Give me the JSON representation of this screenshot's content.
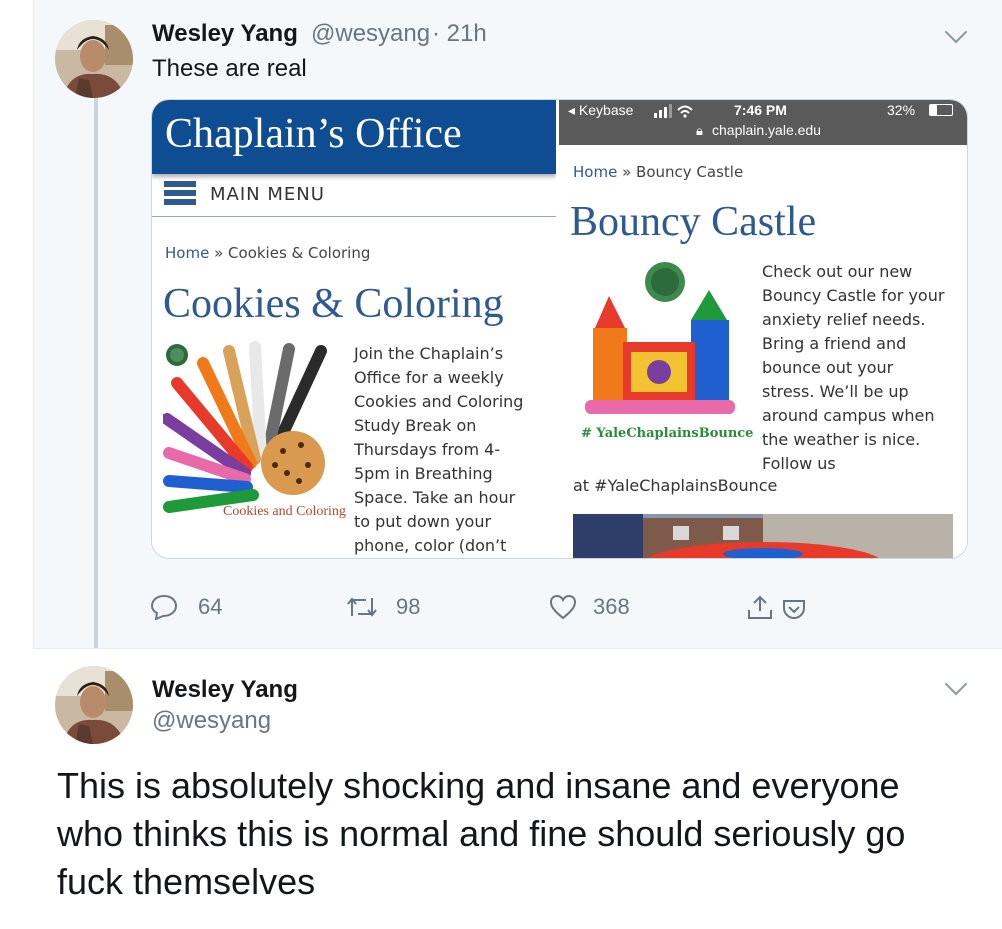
{
  "tweet1": {
    "name": "Wesley Yang",
    "handle": "@wesyang",
    "time": "· 21h",
    "text": "These are real",
    "actions": {
      "replies": "64",
      "retweets": "98",
      "likes": "368"
    }
  },
  "screenshot_left": {
    "site_title": "Chaplain’s Office",
    "menu_label": "MAIN MENU",
    "breadcrumb_home": "Home",
    "breadcrumb_sep": "»",
    "breadcrumb_current": "Cookies & Coloring",
    "heading": "Cookies & Coloring",
    "image_caption": "Cookies and Coloring",
    "body_lines": [
      "Join the Chaplain’s",
      "Office for a weekly",
      "Cookies and Coloring",
      "Study Break on",
      "Thursdays from 4-",
      "5pm in Breathing",
      "Space. Take an hour",
      "to put down your",
      "phone, color (don’t"
    ]
  },
  "screenshot_right": {
    "status_carrier": "◂ Keybase",
    "status_time": "7:46 PM",
    "status_battery": "32%",
    "url": "chaplain.yale.edu",
    "breadcrumb_home": "Home",
    "breadcrumb_sep": "»",
    "breadcrumb_current": "Bouncy Castle",
    "heading": "Bouncy Castle",
    "hashtag_caption": "# YaleChaplainsBounce",
    "body_lines": [
      "Check out our new",
      "Bouncy Castle for your",
      "anxiety relief needs.",
      "Bring a friend and",
      "bounce out your",
      "stress. We’ll be up",
      "around campus when",
      "the weather is nice.",
      "Follow us"
    ],
    "body_tail": "at #YaleChaplainsBounce"
  },
  "tweet2": {
    "name": "Wesley Yang",
    "handle": "@wesyang",
    "text": "This is absolutely shocking and insane and everyone who thinks this is normal and fine should seriously go fuck themselves"
  },
  "colors": {
    "yale_blue": "#0f4d92",
    "link_blue": "#2f5a8f",
    "bg_tweet": "#f5f8fa",
    "muted": "#657786"
  }
}
